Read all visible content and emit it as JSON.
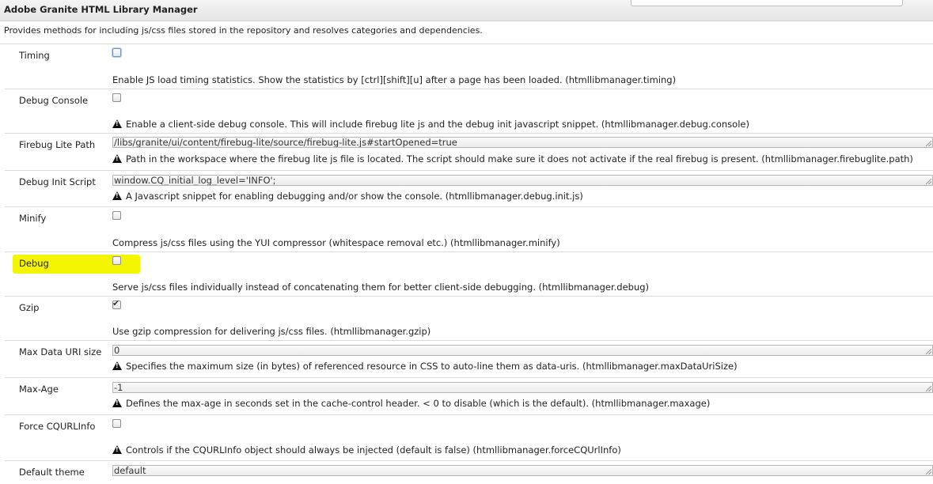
{
  "header": {
    "title": "Adobe Granite HTML Library Manager",
    "description": "Provides methods for including js/css files stored in the repository and resolves categories and dependencies."
  },
  "rows": [
    {
      "label": "Timing",
      "type": "checkbox",
      "checked": false,
      "help": "Enable JS load timing statistics. Show the statistics by [ctrl][shift][u] after a page has been loaded. (htmllibmanager.timing)",
      "warning": false
    },
    {
      "label": "Debug Console",
      "type": "checkbox",
      "checked": false,
      "help": "Enable a client-side debug console. This will include firebug lite js and the debug init javascript snippet. (htmllibmanager.debug.console)",
      "warning": true
    },
    {
      "label": "Firebug Lite Path",
      "type": "text",
      "value": "/libs/granite/ui/content/firebug-lite/source/firebug-lite.js#startOpened=true",
      "help": "Path in the workspace where the firebug lite js file is located. The script should make sure it does not activate if the real firebug is present. (htmllibmanager.firebuglite.path)",
      "warning": true
    },
    {
      "label": "Debug Init Script",
      "type": "text",
      "value": "window.CQ_initial_log_level='INFO';",
      "help": "A Javascript snippet for enabling debugging and/or show the console. (htmllibmanager.debug.init.js)",
      "warning": true
    },
    {
      "label": "Minify",
      "type": "checkbox",
      "checked": false,
      "help": "Compress js/css files using the YUI compressor (whitespace removal etc.) (htmllibmanager.minify)",
      "warning": false
    },
    {
      "label": "Debug",
      "type": "checkbox",
      "checked": false,
      "help": "Serve js/css files individually instead of concatenating them for better client-side debugging. (htmllibmanager.debug)",
      "warning": false,
      "highlight_color": "#f5f500"
    },
    {
      "label": "Gzip",
      "type": "checkbox",
      "checked": true,
      "help": "Use gzip compression for delivering js/css files. (htmllibmanager.gzip)",
      "warning": false
    },
    {
      "label": "Max Data URI size",
      "type": "text",
      "value": "0",
      "help": "Specifies the maximum size (in bytes) of referenced resource in CSS to auto-line them as data-uris. (htmllibmanager.maxDataUriSize)",
      "warning": true
    },
    {
      "label": "Max-Age",
      "type": "text",
      "value": "-1",
      "help": "Defines the max-age in seconds set in the cache-control header. < 0 to disable (which is the default). (htmllibmanager.maxage)",
      "warning": true
    },
    {
      "label": "Force CQURLInfo",
      "type": "checkbox",
      "checked": false,
      "help": "Controls if the CQURLInfo object should always be injected (default is false) (htmllibmanager.forceCQUrlInfo)",
      "warning": true
    },
    {
      "label": "Default theme",
      "type": "text",
      "value": "default",
      "help": "",
      "warning": false
    }
  ]
}
